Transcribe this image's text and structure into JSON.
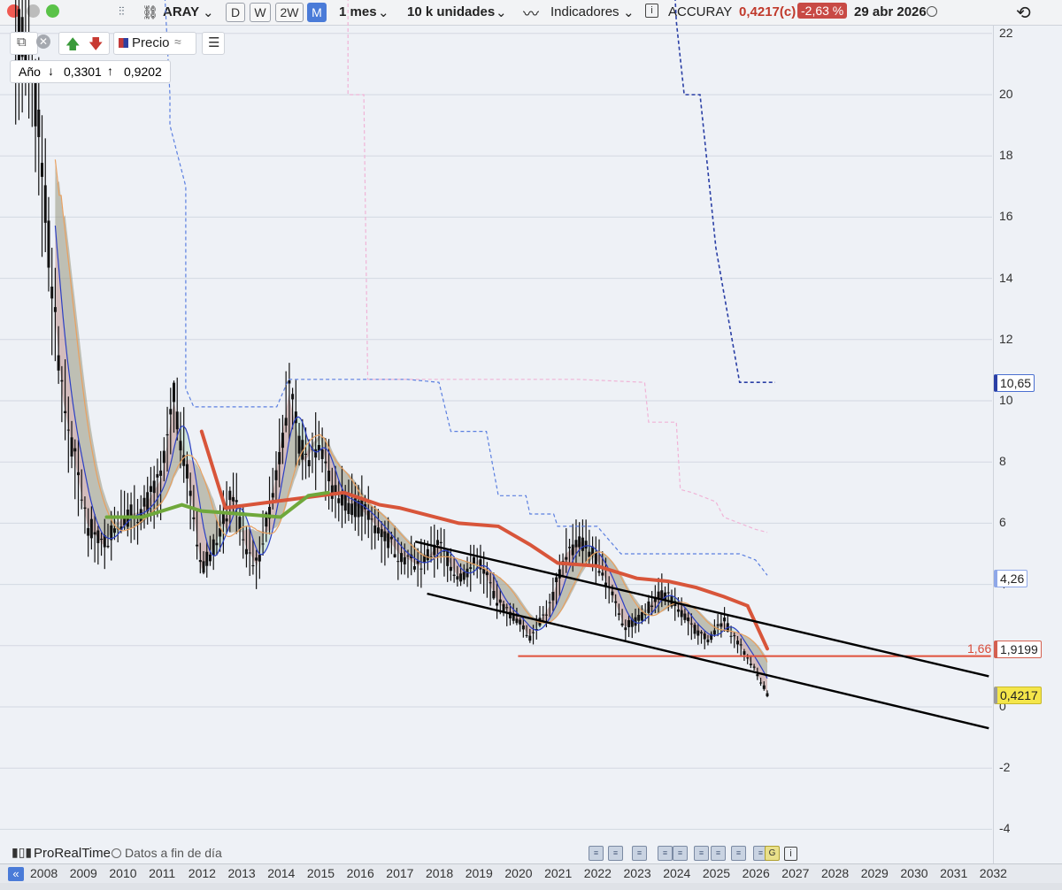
{
  "toolbar": {
    "ticker": "ARAY",
    "periods": [
      "D",
      "W",
      "2W",
      "M"
    ],
    "active_period": "M",
    "timeframe": "1 mes",
    "units": "10 k unidades",
    "indicators": "Indicadores",
    "instrument_name": "ACCURAY",
    "last_price": "0,4217(c)",
    "change_pct": "-2,63 %",
    "date": "29 abr 2026"
  },
  "legend": {
    "price_label": "Precio",
    "period_label": "Año",
    "low": "0,3301",
    "high": "0,9202"
  },
  "footer": {
    "brand": "ProRealTime",
    "data_note": "Datos a fin de día"
  },
  "price_labels": {
    "blue_level": "10,65",
    "mid_level": "4,26",
    "support_level": "1,9199",
    "support_tag": "1,66",
    "current": "0,4217"
  },
  "colors": {
    "candles": "#111111",
    "sma_red": "#d8553a",
    "sma_green": "#6fa83b",
    "support_line": "#e0503a",
    "channel": "#000000",
    "dashed_blue": "#5b7fe0",
    "dashed_navy": "#2a3fa5",
    "dashed_pink": "#f0b3d6",
    "current_bg": "#f4e64a"
  },
  "chart_data": {
    "type": "candlestick",
    "x_ticks": [
      "2008",
      "2009",
      "2010",
      "2011",
      "2012",
      "2013",
      "2014",
      "2015",
      "2016",
      "2017",
      "2018",
      "2019",
      "2020",
      "2021",
      "2022",
      "2023",
      "2024",
      "2025",
      "2026",
      "2027",
      "2028",
      "2029",
      "2030",
      "2031",
      "2032"
    ],
    "y_ticks": [
      "22",
      "20",
      "18",
      "16",
      "14",
      "12",
      "10",
      "8",
      "6",
      "4",
      "2",
      "0",
      "-2",
      "-4"
    ],
    "ylim": [
      -4.4,
      22.5
    ],
    "price_path": [
      [
        2007.5,
        21.8
      ],
      [
        2007.9,
        19.0
      ],
      [
        2008.2,
        14.0
      ],
      [
        2008.5,
        10.0
      ],
      [
        2008.8,
        8.0
      ],
      [
        2009.1,
        6.0
      ],
      [
        2009.5,
        5.3
      ],
      [
        2010.0,
        6.2
      ],
      [
        2010.5,
        6.4
      ],
      [
        2011.0,
        7.5
      ],
      [
        2011.3,
        10.0
      ],
      [
        2011.6,
        8.0
      ],
      [
        2012.0,
        4.5
      ],
      [
        2012.4,
        5.5
      ],
      [
        2012.8,
        7.0
      ],
      [
        2013.1,
        5.3
      ],
      [
        2013.4,
        4.6
      ],
      [
        2013.8,
        7.0
      ],
      [
        2014.2,
        10.2
      ],
      [
        2014.6,
        8.0
      ],
      [
        2015.0,
        8.8
      ],
      [
        2015.3,
        7.0
      ],
      [
        2016.0,
        6.5
      ],
      [
        2016.5,
        5.8
      ],
      [
        2017.0,
        5.0
      ],
      [
        2017.5,
        4.6
      ],
      [
        2018.0,
        5.3
      ],
      [
        2018.5,
        4.2
      ],
      [
        2019.0,
        4.8
      ],
      [
        2019.5,
        3.4
      ],
      [
        2020.0,
        2.8
      ],
      [
        2020.3,
        2.3
      ],
      [
        2020.8,
        3.3
      ],
      [
        2021.2,
        5.0
      ],
      [
        2021.6,
        5.4
      ],
      [
        2022.0,
        4.8
      ],
      [
        2022.4,
        3.6
      ],
      [
        2022.7,
        2.6
      ],
      [
        2023.1,
        2.9
      ],
      [
        2023.6,
        3.8
      ],
      [
        2024.0,
        3.3
      ],
      [
        2024.4,
        2.6
      ],
      [
        2024.8,
        2.2
      ],
      [
        2025.2,
        2.8
      ],
      [
        2025.6,
        2.0
      ],
      [
        2026.0,
        1.2
      ],
      [
        2026.3,
        0.42
      ]
    ],
    "sma_red_top": [
      [
        2012.0,
        9.0
      ],
      [
        2012.6,
        6.5
      ],
      [
        2015.6,
        7.0
      ],
      [
        2016.5,
        6.6
      ],
      [
        2017.0,
        6.5
      ],
      [
        2018.5,
        6.0
      ],
      [
        2019.5,
        5.9
      ],
      [
        2020.3,
        5.3
      ],
      [
        2021.0,
        4.7
      ],
      [
        2022.0,
        4.6
      ],
      [
        2023.0,
        4.2
      ],
      [
        2023.8,
        4.1
      ],
      [
        2024.5,
        3.9
      ],
      [
        2025.2,
        3.6
      ],
      [
        2025.8,
        3.3
      ],
      [
        2026.3,
        1.9
      ]
    ],
    "sma_green": [
      [
        2009.6,
        6.2
      ],
      [
        2010.5,
        6.2
      ],
      [
        2011.5,
        6.6
      ],
      [
        2012.0,
        6.4
      ],
      [
        2013.0,
        6.3
      ],
      [
        2014.0,
        6.2
      ],
      [
        2014.7,
        6.9
      ],
      [
        2015.2,
        7.0
      ]
    ],
    "support_y": 1.66,
    "channel_upper": [
      [
        2017.4,
        5.4
      ],
      [
        2031.9,
        1.0
      ]
    ],
    "channel_lower": [
      [
        2017.7,
        3.7
      ],
      [
        2031.9,
        -0.7
      ]
    ],
    "dashed_blue_1": [
      [
        2011.0,
        25.0
      ],
      [
        2011.2,
        20.0
      ],
      [
        2011.2,
        19.0
      ],
      [
        2011.6,
        17.0
      ],
      [
        2011.6,
        10.4
      ],
      [
        2011.8,
        9.8
      ],
      [
        2013.9,
        9.8
      ],
      [
        2014.2,
        10.7
      ],
      [
        2017.2,
        10.7
      ],
      [
        2018.0,
        10.6
      ],
      [
        2018.3,
        9.0
      ],
      [
        2019.2,
        9.0
      ],
      [
        2019.5,
        6.9
      ],
      [
        2020.2,
        6.9
      ],
      [
        2020.3,
        6.3
      ],
      [
        2020.9,
        6.3
      ],
      [
        2021.0,
        5.9
      ],
      [
        2022.0,
        5.9
      ],
      [
        2022.6,
        5.0
      ],
      [
        2025.6,
        5.0
      ],
      [
        2026.0,
        4.8
      ],
      [
        2026.3,
        4.3
      ]
    ],
    "dashed_pink": [
      [
        2015.7,
        25.0
      ],
      [
        2015.7,
        20.0
      ],
      [
        2016.1,
        20.0
      ],
      [
        2016.2,
        10.7
      ],
      [
        2021.5,
        10.7
      ],
      [
        2023.2,
        10.6
      ],
      [
        2023.3,
        9.3
      ],
      [
        2024.0,
        9.3
      ],
      [
        2024.1,
        7.1
      ],
      [
        2024.4,
        7.0
      ],
      [
        2025.0,
        6.7
      ],
      [
        2025.2,
        6.2
      ],
      [
        2025.6,
        6.0
      ],
      [
        2026.0,
        5.8
      ],
      [
        2026.3,
        5.7
      ]
    ],
    "dashed_navy": [
      [
        2023.9,
        25.0
      ],
      [
        2024.0,
        22.4
      ],
      [
        2024.2,
        20.0
      ],
      [
        2024.6,
        20.0
      ],
      [
        2025.0,
        15.0
      ],
      [
        2025.6,
        10.6
      ],
      [
        2026.5,
        10.6
      ]
    ]
  }
}
